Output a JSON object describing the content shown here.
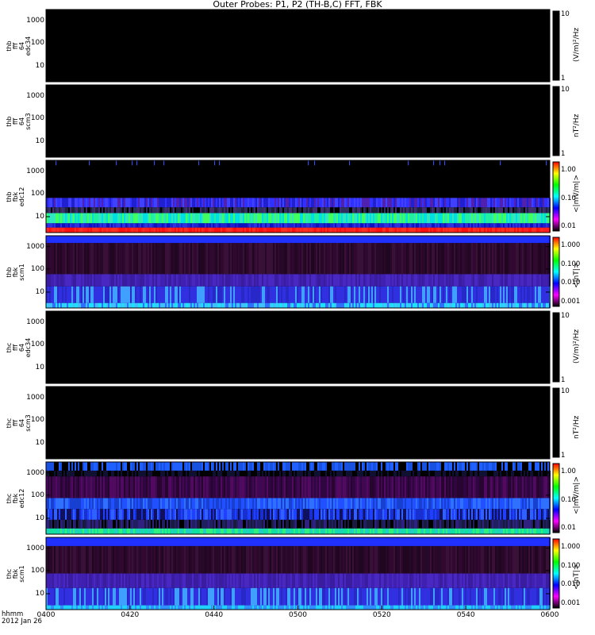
{
  "chart_data": {
    "type": "heatmap",
    "title": "Outer Probes: P1, P2 (TH-B,C) FFT, FBK",
    "x_axis": {
      "title_lines": [
        "hhmm",
        "2012 Jan 26"
      ],
      "ticks": [
        "0400",
        "0420",
        "0440",
        "0500",
        "0520",
        "0540",
        "0600"
      ],
      "range": [
        "04:00",
        "06:00"
      ]
    },
    "panels": [
      {
        "ylabel": [
          "thb",
          "fff",
          "64",
          "edc34"
        ],
        "yticks": [
          "1000",
          "100",
          "10"
        ],
        "colorbar_unit": "(V/m)²/Hz",
        "colorbar_ticks": [
          "10",
          "1"
        ],
        "colorbar_scale": "log",
        "fill": "#000000",
        "kind": "empty"
      },
      {
        "ylabel": [
          "thb",
          "fff",
          "64",
          "scm3"
        ],
        "yticks": [
          "1000",
          "100",
          "10"
        ],
        "colorbar_unit": "nT²/Hz",
        "colorbar_ticks": [
          "10",
          "1"
        ],
        "colorbar_scale": "log",
        "fill": "#000000",
        "kind": "empty"
      },
      {
        "ylabel": [
          "thb",
          "fbk",
          "edc12"
        ],
        "yticks": [
          "1000",
          "100",
          "10"
        ],
        "colorbar_unit": "<|mV/m|>",
        "colorbar_ticks": [
          "1.00",
          "0.10",
          "0.01"
        ],
        "colorbar_scale": "log",
        "colorbar_colors": [
          "#ff0000",
          "#ffff00",
          "#00ff00",
          "#00ffff",
          "#0000ff",
          "#ff00ff",
          "#000000"
        ],
        "kind": "edc",
        "seed": 11,
        "bands": [
          {
            "from": 0.0,
            "to": 0.07,
            "colors": [
              "#ff2020",
              "#ff1010",
              "#ff3020"
            ]
          },
          {
            "from": 0.07,
            "to": 0.13,
            "colors": [
              "#1010c0",
              "#2020d0",
              "#3030e0"
            ]
          },
          {
            "from": 0.13,
            "to": 0.27,
            "colors": [
              "#20f0a0",
              "#00e0e0",
              "#40ff60",
              "#30e8c0"
            ]
          },
          {
            "from": 0.27,
            "to": 0.35,
            "colors": [
              "#303060",
              "#202040",
              "#403070",
              "#000000"
            ]
          },
          {
            "from": 0.35,
            "to": 0.48,
            "colors": [
              "#3030ff",
              "#2020d0",
              "#4040ff",
              "#5020b0"
            ]
          },
          {
            "from": 0.48,
            "to": 1.0,
            "colors": [
              "#000000"
            ]
          }
        ],
        "spikes": {
          "from": 0.93,
          "to": 1.0,
          "color": "#3050ff",
          "density": 0.05
        }
      },
      {
        "ylabel": [
          "thb",
          "fbk",
          "scm1"
        ],
        "yticks": [
          "1000",
          "100",
          "10"
        ],
        "colorbar_unit": "<|nT|>",
        "colorbar_ticks": [
          "1.000",
          "0.100",
          "0.010",
          "0.001"
        ],
        "colorbar_scale": "log",
        "colorbar_colors": [
          "#ff0000",
          "#ffff00",
          "#00ff00",
          "#00ffff",
          "#0000ff",
          "#ff00ff",
          "#000000"
        ],
        "kind": "scm",
        "seed": 23,
        "bands": [
          {
            "from": 0.0,
            "to": 0.07,
            "colors": [
              "#20e0ff",
              "#40c0ff",
              "#3070ff"
            ]
          },
          {
            "from": 0.07,
            "to": 0.3,
            "colors": [
              "#3030e0",
              "#2828c8",
              "#40a0ff",
              "#3030e0"
            ]
          },
          {
            "from": 0.3,
            "to": 0.47,
            "colors": [
              "#4020b0",
              "#3a1ca0",
              "#4828c0"
            ]
          },
          {
            "from": 0.47,
            "to": 0.9,
            "colors": [
              "#300830",
              "#280828",
              "#381038",
              "#200620"
            ]
          },
          {
            "from": 0.9,
            "to": 1.0,
            "colors": [
              "#2030ff"
            ]
          }
        ]
      },
      {
        "ylabel": [
          "thc",
          "fff",
          "64",
          "edc34"
        ],
        "yticks": [
          "1000",
          "100",
          "10"
        ],
        "colorbar_unit": "(V/m)²/Hz",
        "colorbar_ticks": [
          "10",
          "1"
        ],
        "colorbar_scale": "log",
        "fill": "#000000",
        "kind": "empty"
      },
      {
        "ylabel": [
          "thc",
          "fff",
          "64",
          "scm3"
        ],
        "yticks": [
          "1000",
          "100",
          "10"
        ],
        "colorbar_unit": "nT²/Hz",
        "colorbar_ticks": [
          "10",
          "1"
        ],
        "colorbar_scale": "log",
        "fill": "#000000",
        "kind": "empty"
      },
      {
        "ylabel": [
          "thc",
          "fbk",
          "edc12"
        ],
        "yticks": [
          "1000",
          "100",
          "10"
        ],
        "colorbar_unit": "<|mV/m|>",
        "colorbar_ticks": [
          "1.00",
          "0.10",
          "0.01"
        ],
        "colorbar_scale": "log",
        "colorbar_colors": [
          "#ff0000",
          "#ffff00",
          "#00ff00",
          "#00ffff",
          "#0000ff",
          "#ff00ff",
          "#000000"
        ],
        "kind": "edc",
        "seed": 37,
        "bands": [
          {
            "from": 0.0,
            "to": 0.08,
            "colors": [
              "#10e0a0",
              "#20d0c0",
              "#30f080"
            ]
          },
          {
            "from": 0.08,
            "to": 0.2,
            "colors": [
              "#1a1a40",
              "#000000",
              "#202060",
              "#302080"
            ]
          },
          {
            "from": 0.2,
            "to": 0.35,
            "colors": [
              "#2040ff",
              "#1830d0",
              "#3060ff",
              "#101060"
            ]
          },
          {
            "from": 0.35,
            "to": 0.5,
            "colors": [
              "#2050ff",
              "#1840d0",
              "#3070ff"
            ]
          },
          {
            "from": 0.5,
            "to": 0.8,
            "colors": [
              "#400850",
              "#300640",
              "#500a60",
              "#280530"
            ]
          },
          {
            "from": 0.8,
            "to": 0.88,
            "colors": [
              "#000000",
              "#101030"
            ]
          },
          {
            "from": 0.88,
            "to": 1.0,
            "colors": [
              "#2060ff",
              "#1850e0",
              "#000000"
            ]
          }
        ]
      },
      {
        "ylabel": [
          "thc",
          "fbk",
          "scm1"
        ],
        "yticks": [
          "1000",
          "100",
          "10"
        ],
        "colorbar_unit": "<|nT|>",
        "colorbar_ticks": [
          "1.000",
          "0.100",
          "0.010",
          "0.001"
        ],
        "colorbar_scale": "log",
        "colorbar_colors": [
          "#ff0000",
          "#ffff00",
          "#00ff00",
          "#00ffff",
          "#0000ff",
          "#ff00ff",
          "#000000"
        ],
        "kind": "scm",
        "seed": 53,
        "bands": [
          {
            "from": 0.0,
            "to": 0.06,
            "colors": [
              "#20d0ff",
              "#3090ff"
            ]
          },
          {
            "from": 0.06,
            "to": 0.3,
            "colors": [
              "#3030e0",
              "#2828c8",
              "#40a0ff",
              "#3030e0"
            ]
          },
          {
            "from": 0.3,
            "to": 0.5,
            "colors": [
              "#4020b0",
              "#3a1ca0",
              "#4828c0"
            ]
          },
          {
            "from": 0.5,
            "to": 0.88,
            "colors": [
              "#300830",
              "#280828",
              "#381038",
              "#200620"
            ]
          },
          {
            "from": 0.88,
            "to": 1.0,
            "colors": [
              "#2030ff"
            ]
          }
        ]
      }
    ]
  }
}
